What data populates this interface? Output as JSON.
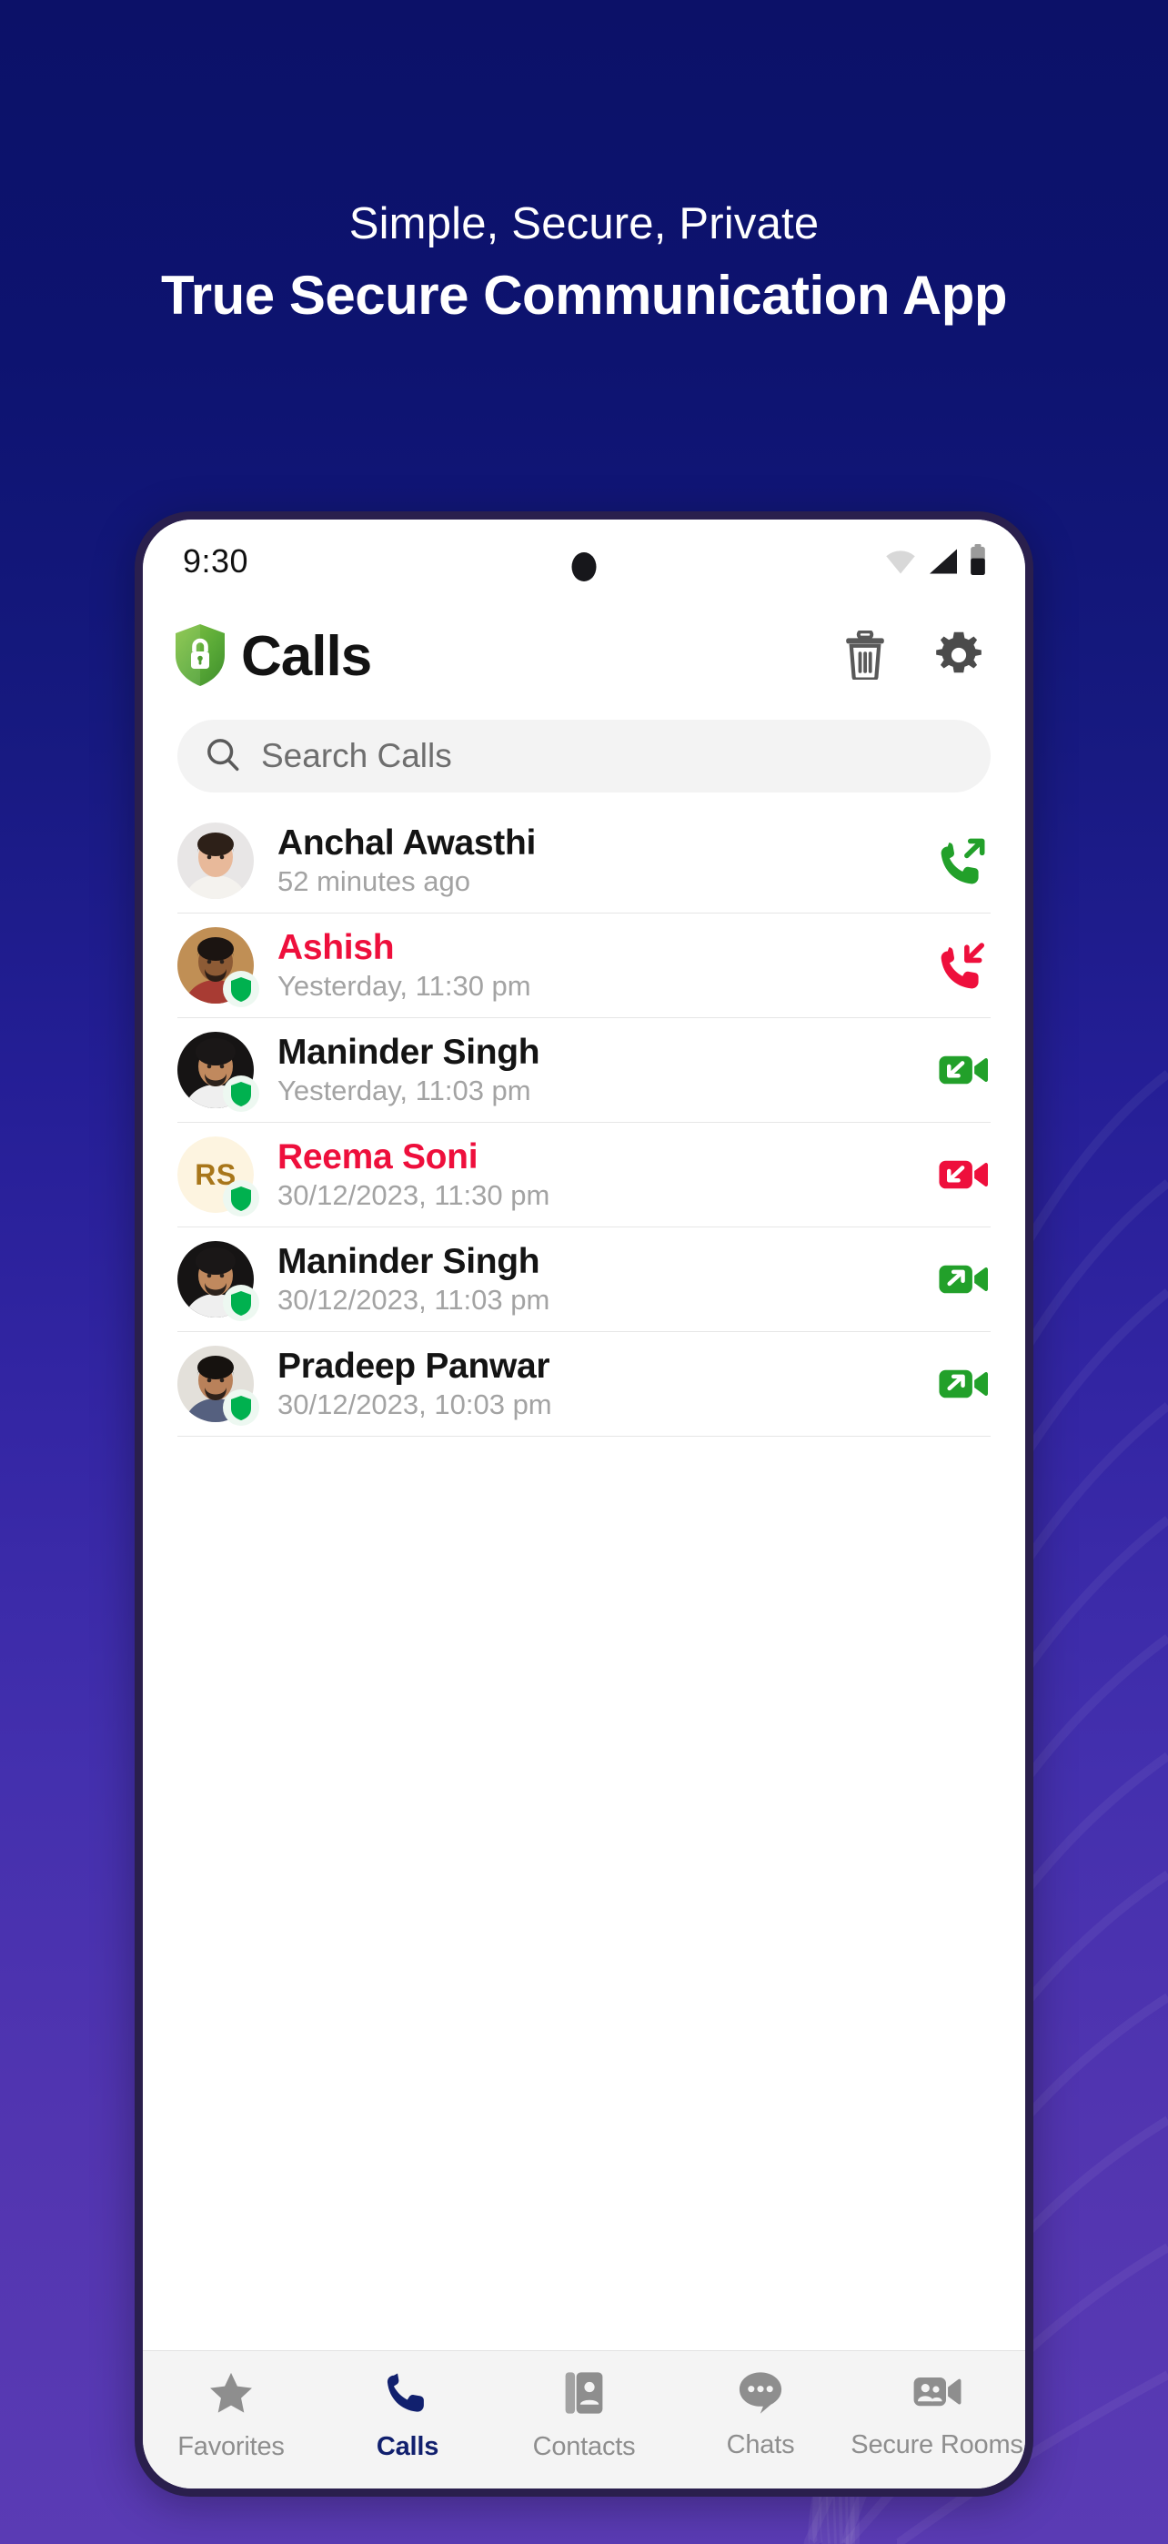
{
  "promo": {
    "subtitle": "Simple, Secure, Private",
    "title": "True Secure Communication App"
  },
  "colors": {
    "bg_top": "#0c1168",
    "bg_bottom": "#5a3bb4",
    "accent_green": "#22a02a",
    "accent_red": "#ee0f3c",
    "nav_active": "#11206e",
    "shield_green": "#00b14f",
    "search_bg": "#f3f3f3",
    "muted_text": "#a3a3a3"
  },
  "status_bar": {
    "time": "9:30",
    "icons": [
      "wifi-icon",
      "cellular-signal-icon",
      "battery-icon"
    ]
  },
  "header": {
    "logo": "shield-lock-icon",
    "title": "Calls",
    "actions": [
      {
        "name": "delete-button",
        "icon": "trash-icon"
      },
      {
        "name": "settings-button",
        "icon": "gear-icon"
      }
    ]
  },
  "search": {
    "icon": "search-icon",
    "placeholder": "Search Calls",
    "value": ""
  },
  "calls": [
    {
      "name": "Anchal Awasthi",
      "time": "52 minutes ago",
      "missed": false,
      "verified": false,
      "avatar_type": "photo",
      "avatar_style": "woman-white-top",
      "call_icon": "outgoing-voice-call-icon",
      "call_kind": "voice",
      "call_direction": "outgoing",
      "icon_color": "#22a02a"
    },
    {
      "name": "Ashish",
      "time": "Yesterday, 11:30 pm",
      "missed": true,
      "verified": true,
      "avatar_type": "photo",
      "avatar_style": "man-plaid-shirt",
      "call_icon": "missed-incoming-voice-call-icon",
      "call_kind": "voice",
      "call_direction": "incoming",
      "icon_color": "#ee0f3c"
    },
    {
      "name": "Maninder Singh",
      "time": "Yesterday, 11:03 pm",
      "missed": false,
      "verified": true,
      "avatar_type": "photo",
      "avatar_style": "man-turban",
      "call_icon": "incoming-video-call-icon",
      "call_kind": "video",
      "call_direction": "incoming",
      "icon_color": "#22a02a"
    },
    {
      "name": "Reema Soni",
      "time": "30/12/2023, 11:30 pm",
      "missed": true,
      "verified": true,
      "avatar_type": "initials",
      "initials": "RS",
      "initials_bg": "#fdf4e0",
      "initials_fg": "#a8761a",
      "call_icon": "missed-incoming-video-call-icon",
      "call_kind": "video",
      "call_direction": "incoming",
      "icon_color": "#ee0f3c"
    },
    {
      "name": "Maninder Singh",
      "time": "30/12/2023, 11:03 pm",
      "missed": false,
      "verified": true,
      "avatar_type": "photo",
      "avatar_style": "man-turban",
      "call_icon": "outgoing-video-call-icon",
      "call_kind": "video",
      "call_direction": "outgoing",
      "icon_color": "#22a02a"
    },
    {
      "name": "Pradeep Panwar",
      "time": "30/12/2023, 10:03 pm",
      "missed": false,
      "verified": true,
      "avatar_type": "photo",
      "avatar_style": "man-blue-tshirt",
      "call_icon": "outgoing-video-call-icon",
      "call_kind": "video",
      "call_direction": "outgoing",
      "icon_color": "#22a02a"
    }
  ],
  "bottom_nav": {
    "items": [
      {
        "label": "Favorites",
        "icon": "star-icon",
        "active": false
      },
      {
        "label": "Calls",
        "icon": "phone-icon",
        "active": true
      },
      {
        "label": "Contacts",
        "icon": "contact-book-icon",
        "active": false
      },
      {
        "label": "Chats",
        "icon": "chat-bubble-icon",
        "active": false
      },
      {
        "label": "Secure Rooms",
        "icon": "group-video-icon",
        "active": false
      }
    ]
  }
}
